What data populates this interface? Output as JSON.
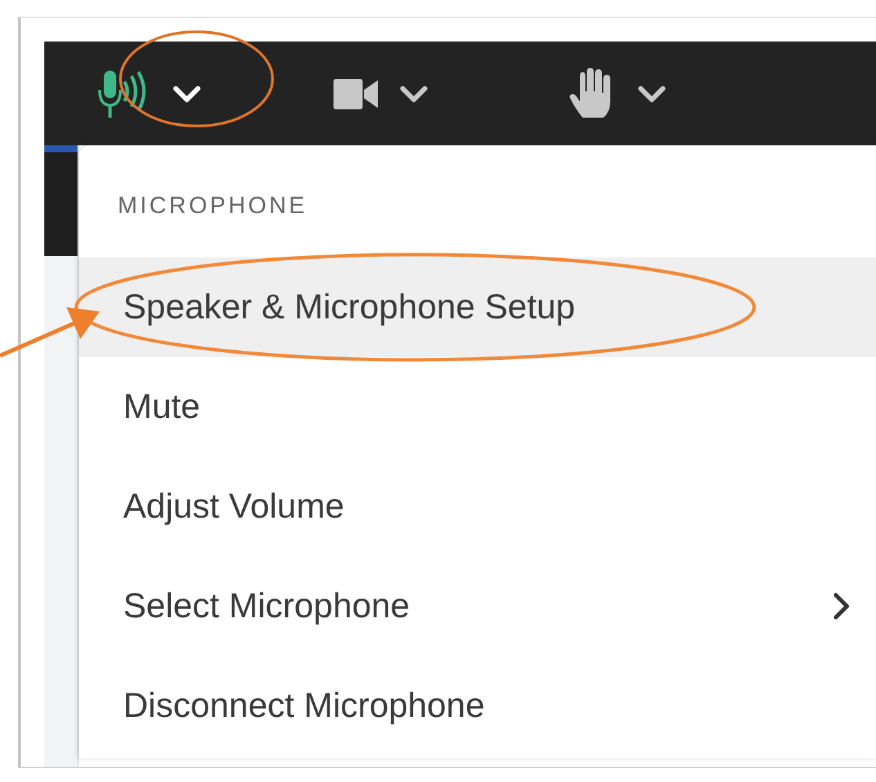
{
  "toolbar": {
    "buttons": [
      {
        "kind": "microphone",
        "active": true
      },
      {
        "kind": "camera",
        "active": false
      },
      {
        "kind": "hand",
        "active": false
      }
    ]
  },
  "menu": {
    "header": "MICROPHONE",
    "items": [
      {
        "label": "Speaker & Microphone Setup",
        "selected": true,
        "submenu": false
      },
      {
        "label": "Mute",
        "selected": false,
        "submenu": false
      },
      {
        "label": "Adjust Volume",
        "selected": false,
        "submenu": false
      },
      {
        "label": "Select Microphone",
        "selected": false,
        "submenu": true
      },
      {
        "label": "Disconnect Microphone",
        "selected": false,
        "submenu": false
      }
    ]
  }
}
